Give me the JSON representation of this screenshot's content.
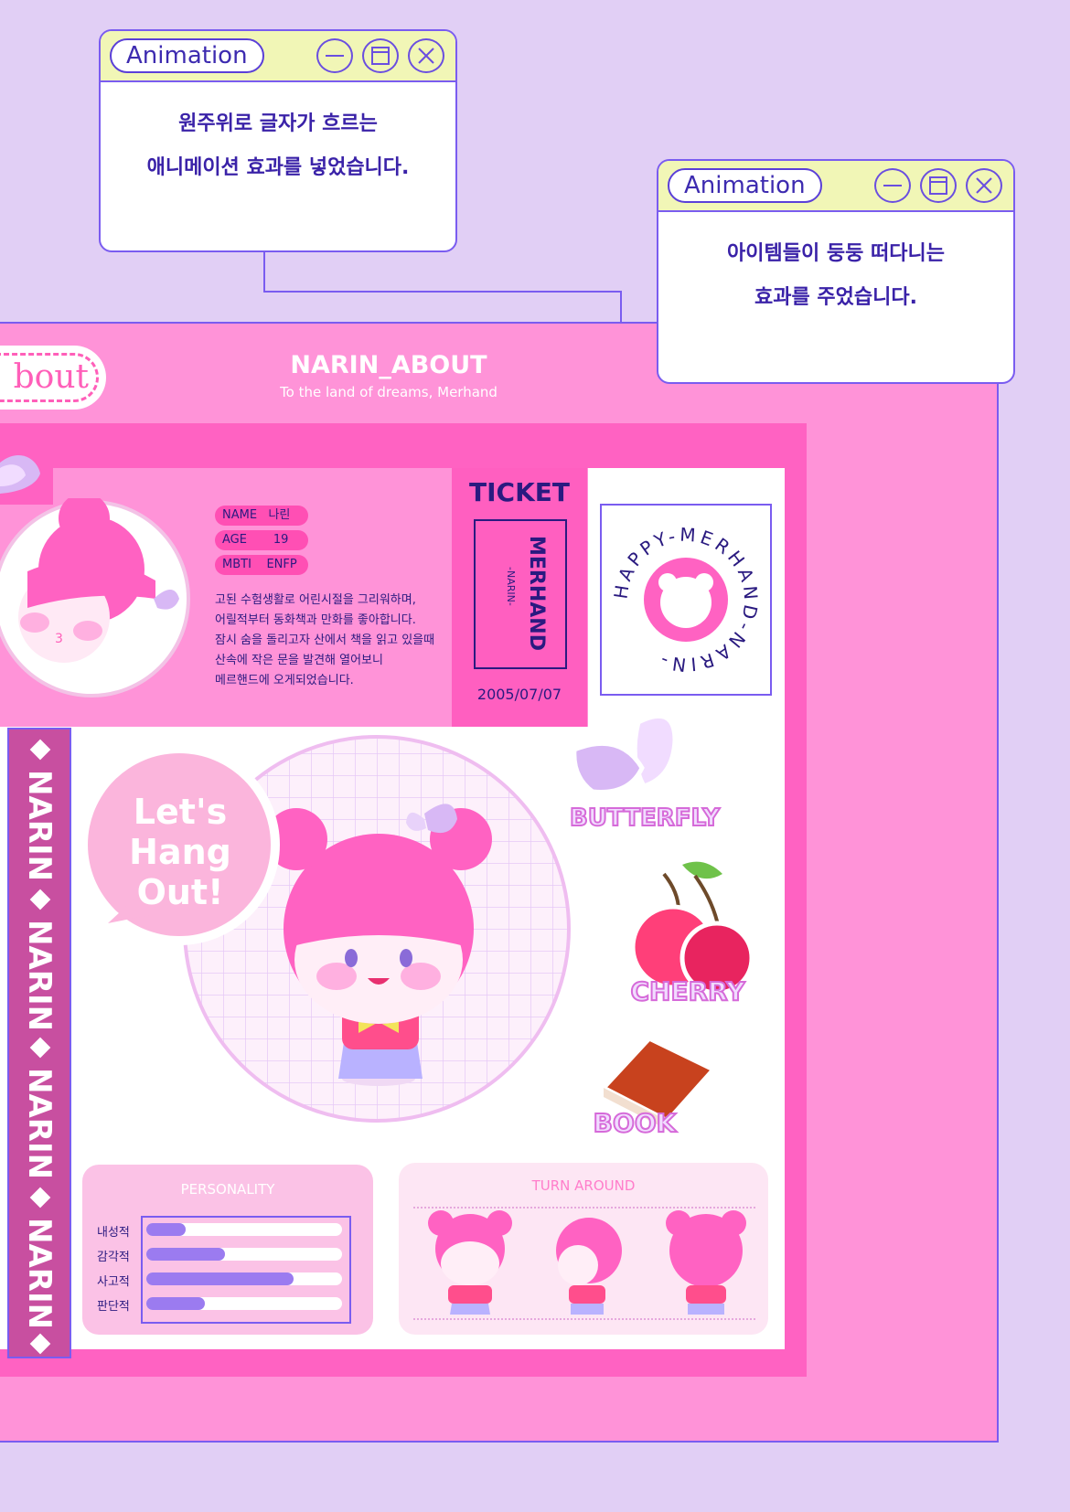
{
  "popup1": {
    "title": "Animation",
    "lines": [
      "원주위로 글자가 흐르는",
      "애니메이션 효과를 넣었습니다."
    ]
  },
  "popup2": {
    "title": "Animation",
    "lines": [
      "아이템들이 둥둥 떠다니는",
      "효과를 주었습니다."
    ]
  },
  "header": {
    "tab_label": "bout",
    "title": "NARIN_ABOUT",
    "subtitle": "To the land of dreams, Merhand"
  },
  "profile": {
    "name_label": "NAME",
    "name_value": "나린",
    "age_label": "AGE",
    "age_value": "19",
    "mbti_label": "MBTI",
    "mbti_value": "ENFP",
    "bio": [
      "고된 수험생활로 어린시절을 그리워하며,",
      "어릴적부터 동화책과 만화를 좋아합니다.",
      "잠시 숨을 돌리고자 산에서 책을 읽고 있을때",
      "산속에 작은 문을 발견해 열어보니",
      "메르핸드에 오게되었습니다."
    ]
  },
  "ticket": {
    "heading": "TICKET",
    "main": "MERHAND",
    "sub": "-NARIN-",
    "date": "2005/07/07"
  },
  "stamp": {
    "ring_text": "HAPPY-MERHAND-NARIN-"
  },
  "strip": {
    "word": "NARIN"
  },
  "speech": {
    "text": "Let's Hang Out!"
  },
  "stickers": {
    "butterfly": "BUTTERFLY",
    "cherry": "CHERRY",
    "book": "BOOK"
  },
  "personality": {
    "title": "PERSONALITY",
    "traits": [
      {
        "label": "내성적",
        "value": 0.2
      },
      {
        "label": "감각적",
        "value": 0.4
      },
      {
        "label": "사고적",
        "value": 0.75
      },
      {
        "label": "판단적",
        "value": 0.3
      }
    ]
  },
  "turnaround": {
    "title": "TURN AROUND"
  },
  "colors": {
    "background": "#e1cff5",
    "pink": "#ff93d8",
    "hot_pink": "#ff62c2",
    "accent": "#7a5cf0",
    "navy": "#2a1a80"
  }
}
